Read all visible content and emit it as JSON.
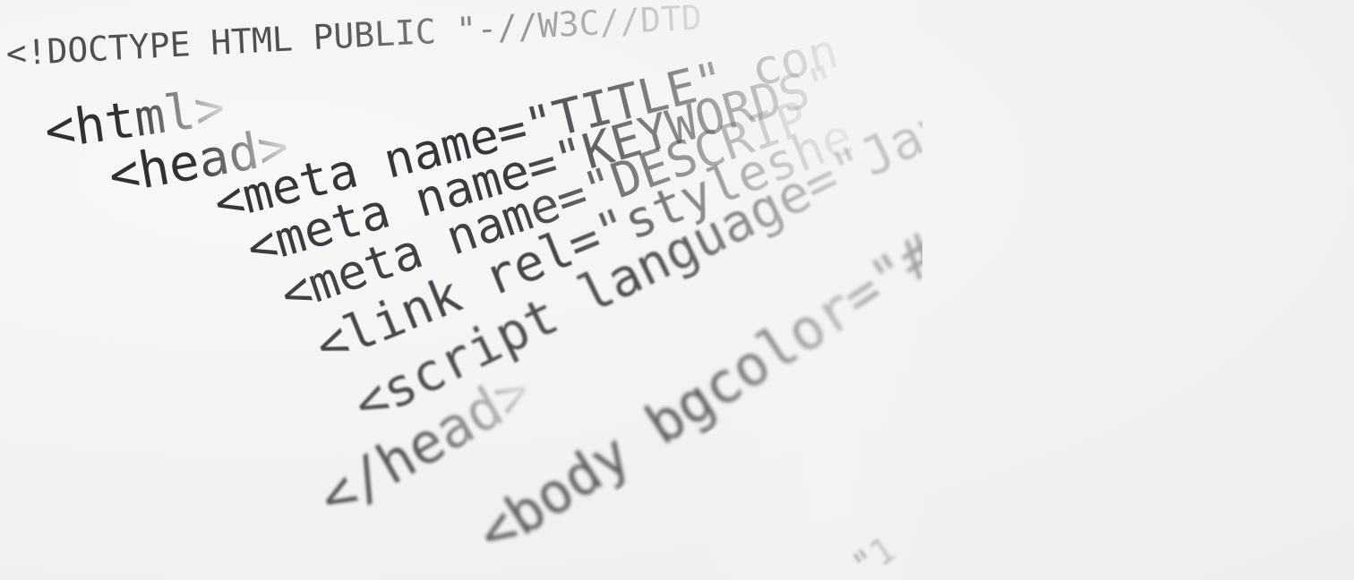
{
  "code_lines": {
    "doctype": "<!DOCTYPE HTML PUBLIC \"-//W3C//DTD",
    "html_open": "<html>",
    "head_open": "<head>",
    "meta_title": "<meta name=\"TITLE\" con",
    "meta_keywords": "<meta name=\"KEYWORDS\"",
    "meta_description": "<meta name=\"DESCRIP",
    "link_rel": "<link rel=\"styleshe",
    "script_language": "<script language=\"Java",
    "head_close": "</head>",
    "body_open": "<body bgcolor=\"#ffffff",
    "attr_fragment": "\"1"
  },
  "colors": {
    "background": "#f4f5f6",
    "text": "#2e3032"
  }
}
